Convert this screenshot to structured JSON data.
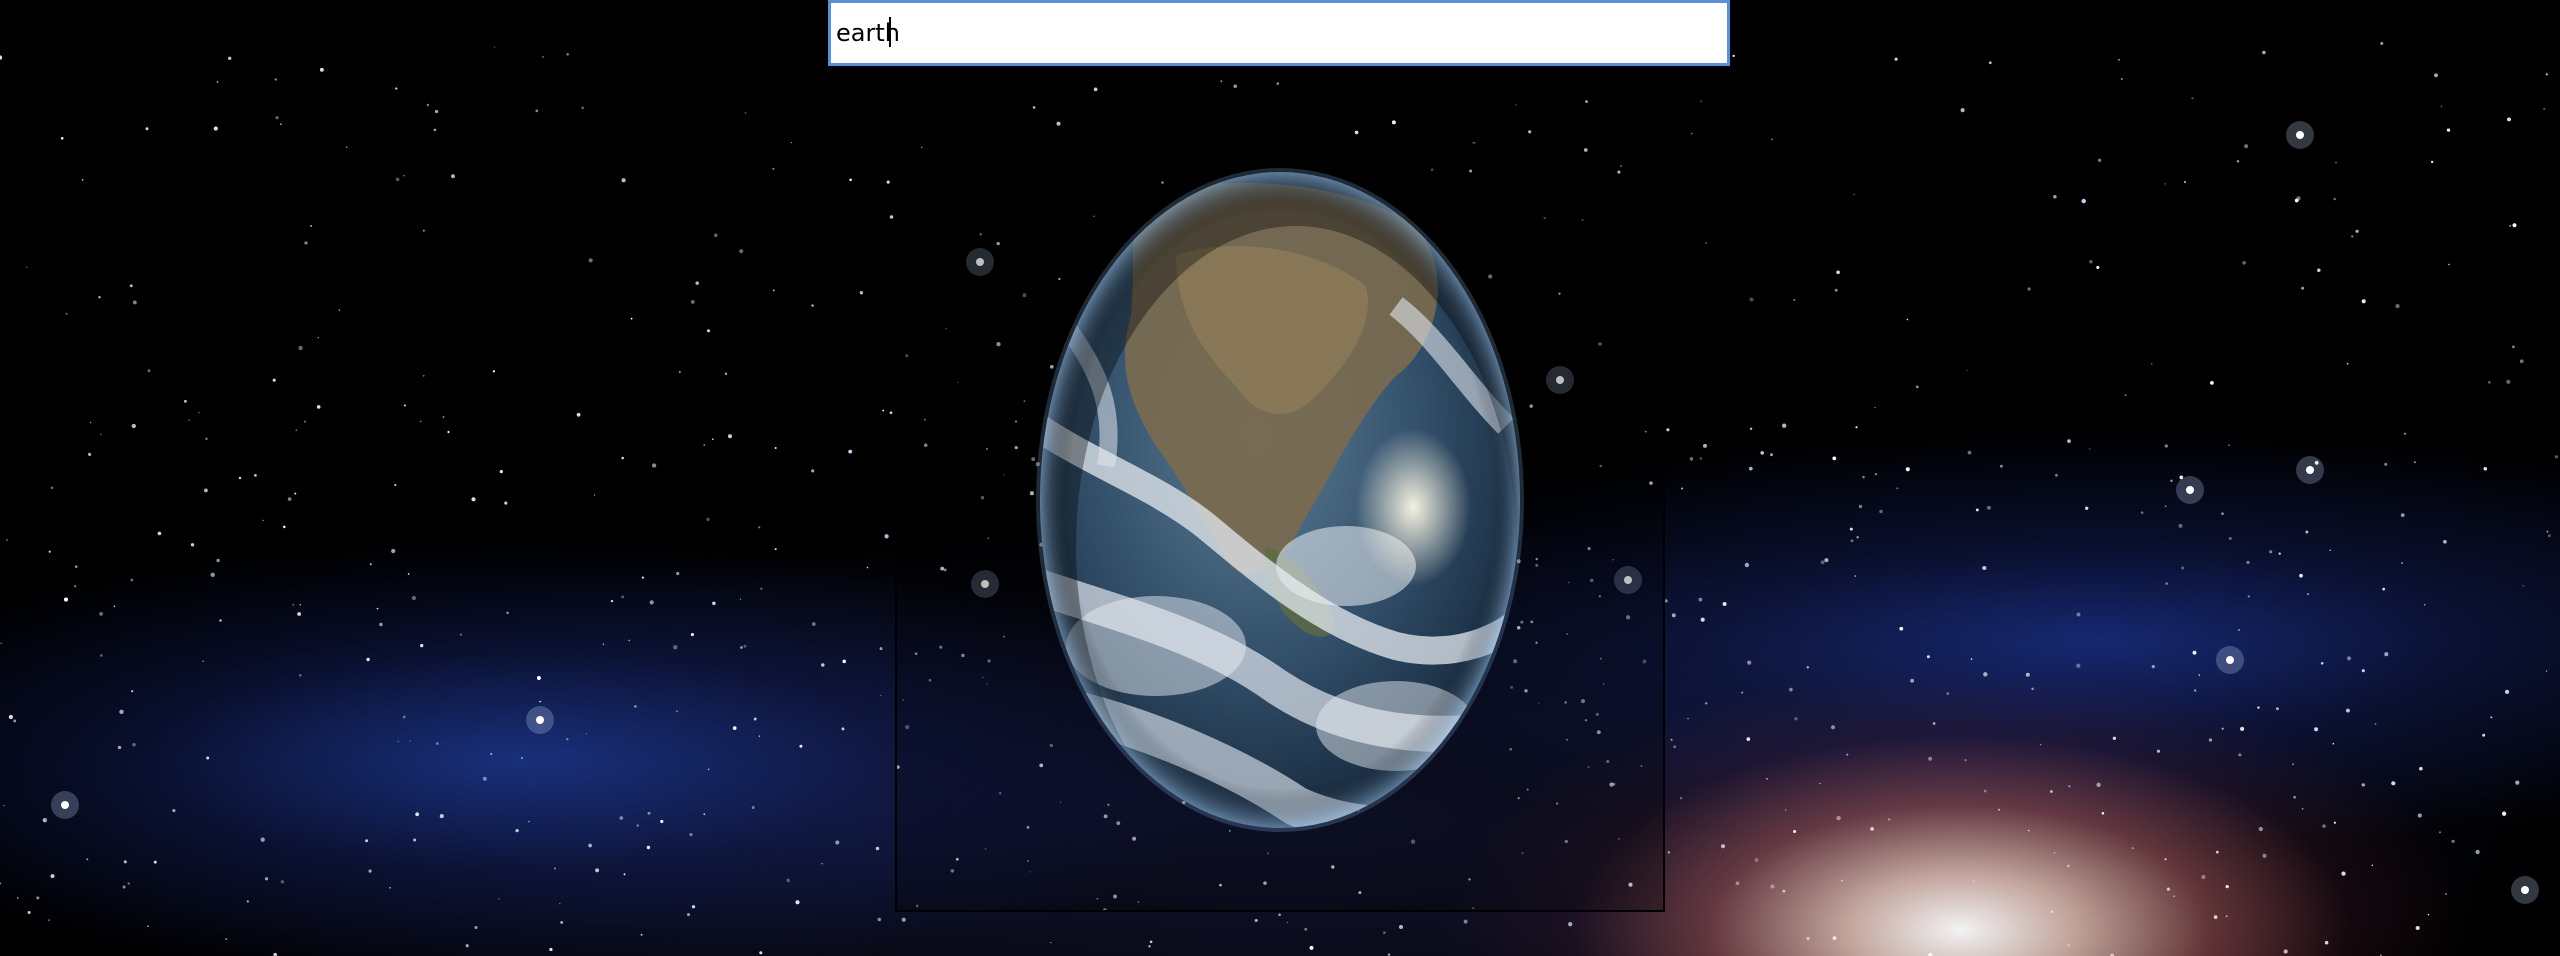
{
  "search": {
    "value": "earth"
  },
  "result": {
    "image_subject": "earth"
  },
  "icons": {
    "earth": "earth-globe-image"
  },
  "colors": {
    "input_border": "#5b8fd6",
    "frame_border": "#000000",
    "background": "#000000"
  }
}
